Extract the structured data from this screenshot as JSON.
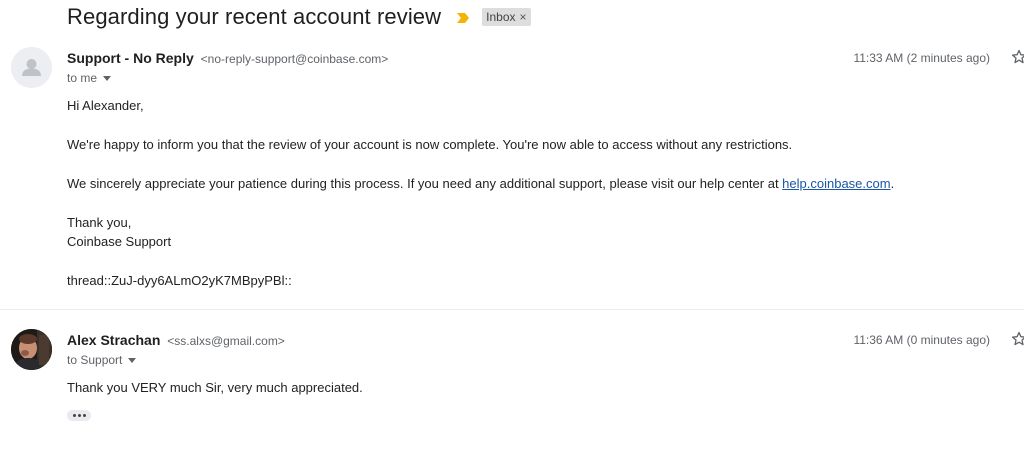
{
  "thread": {
    "subject": "Regarding your recent account review",
    "importance_icon": "importance-marker-icon",
    "label": "Inbox",
    "label_remove": "×",
    "colors": {
      "importance": "#f4b400",
      "link": "#1a56a6"
    }
  },
  "messages": [
    {
      "sender_name": "Support - No Reply",
      "sender_email": "<no-reply-support@coinbase.com>",
      "recipient": "to me",
      "time": "11:33 AM (2 minutes ago)",
      "avatar_icon": "default-person-avatar",
      "greeting": "Hi Alexander,",
      "paragraph1": "We're happy to inform you that the review of your account is now complete. You're now able to access without any restrictions.",
      "paragraph2_text": "We sincerely appreciate your patience during this process. If you need any additional support, please visit our help center at ",
      "paragraph2_link": "help.coinbase.com",
      "paragraph2_end": ".",
      "closing": "Thank you,",
      "signature": "Coinbase Support",
      "thread_id": "thread::ZuJ-dyy6ALmO2yK7MBpyPBl::"
    },
    {
      "sender_name": "Alex Strachan",
      "sender_email": "<ss.alxs@gmail.com>",
      "recipient": "to Support",
      "time": "11:36 AM (0 minutes ago)",
      "avatar_icon": "user-photo-avatar",
      "body": "Thank you VERY much Sir, very much appreciated."
    }
  ]
}
